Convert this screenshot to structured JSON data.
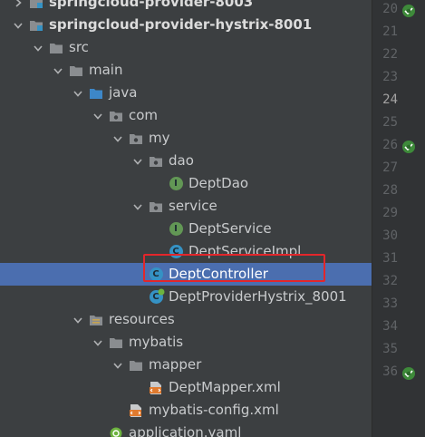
{
  "tree": {
    "rows": [
      {
        "label": "springcloud-provider-8003",
        "indent": 1,
        "arrow": "right",
        "icon": "module-folder-icon",
        "bold": true,
        "partial": true
      },
      {
        "label": "springcloud-provider-hystrix-8001",
        "indent": 1,
        "arrow": "down",
        "icon": "module-folder-icon",
        "bold": true
      },
      {
        "label": "src",
        "indent": 2,
        "arrow": "down",
        "icon": "folder-icon"
      },
      {
        "label": "main",
        "indent": 3,
        "arrow": "down",
        "icon": "folder-icon"
      },
      {
        "label": "java",
        "indent": 4,
        "arrow": "down",
        "icon": "source-folder-icon"
      },
      {
        "label": "com",
        "indent": 5,
        "arrow": "down",
        "icon": "package-icon"
      },
      {
        "label": "my",
        "indent": 6,
        "arrow": "down",
        "icon": "package-icon"
      },
      {
        "label": "dao",
        "indent": 7,
        "arrow": "down",
        "icon": "package-icon"
      },
      {
        "label": "DeptDao",
        "indent": 8,
        "arrow": "none",
        "icon": "interface-icon"
      },
      {
        "label": "service",
        "indent": 7,
        "arrow": "down",
        "icon": "package-icon"
      },
      {
        "label": "DeptService",
        "indent": 8,
        "arrow": "none",
        "icon": "interface-icon"
      },
      {
        "label": "DeptServiceImpl",
        "indent": 8,
        "arrow": "none",
        "icon": "class-icon"
      },
      {
        "label": "DeptController",
        "indent": 7,
        "arrow": "none",
        "icon": "class-icon",
        "selected": true
      },
      {
        "label": "DeptProviderHystrix_8001",
        "indent": 7,
        "arrow": "none",
        "icon": "spring-boot-class-icon"
      },
      {
        "label": "resources",
        "indent": 4,
        "arrow": "down",
        "icon": "resources-folder-icon"
      },
      {
        "label": "mybatis",
        "indent": 5,
        "arrow": "down",
        "icon": "folder-icon"
      },
      {
        "label": "mapper",
        "indent": 6,
        "arrow": "down",
        "icon": "folder-icon"
      },
      {
        "label": "DeptMapper.xml",
        "indent": 7,
        "arrow": "none",
        "icon": "xml-file-icon"
      },
      {
        "label": "mybatis-config.xml",
        "indent": 6,
        "arrow": "none",
        "icon": "xml-file-icon"
      },
      {
        "label": "application.yaml",
        "indent": 5,
        "arrow": "none",
        "icon": "yaml-file-icon"
      }
    ]
  },
  "gutter": {
    "lines": [
      {
        "n": "20",
        "icon": "spring-bean-icon"
      },
      {
        "n": "21"
      },
      {
        "n": "22"
      },
      {
        "n": "23"
      },
      {
        "n": "24",
        "current": true
      },
      {
        "n": "25"
      },
      {
        "n": "26",
        "icon": "spring-bean-icon"
      },
      {
        "n": "27"
      },
      {
        "n": "28"
      },
      {
        "n": "29"
      },
      {
        "n": "30"
      },
      {
        "n": "31"
      },
      {
        "n": "32"
      },
      {
        "n": "33"
      },
      {
        "n": "34"
      },
      {
        "n": "35"
      },
      {
        "n": "36",
        "icon": "spring-bean-icon"
      }
    ]
  },
  "colors": {
    "selection": "#4b6eaf",
    "highlight_border": "#e3262b",
    "interface_badge": "#629755",
    "class_badge": "#3592c4"
  }
}
